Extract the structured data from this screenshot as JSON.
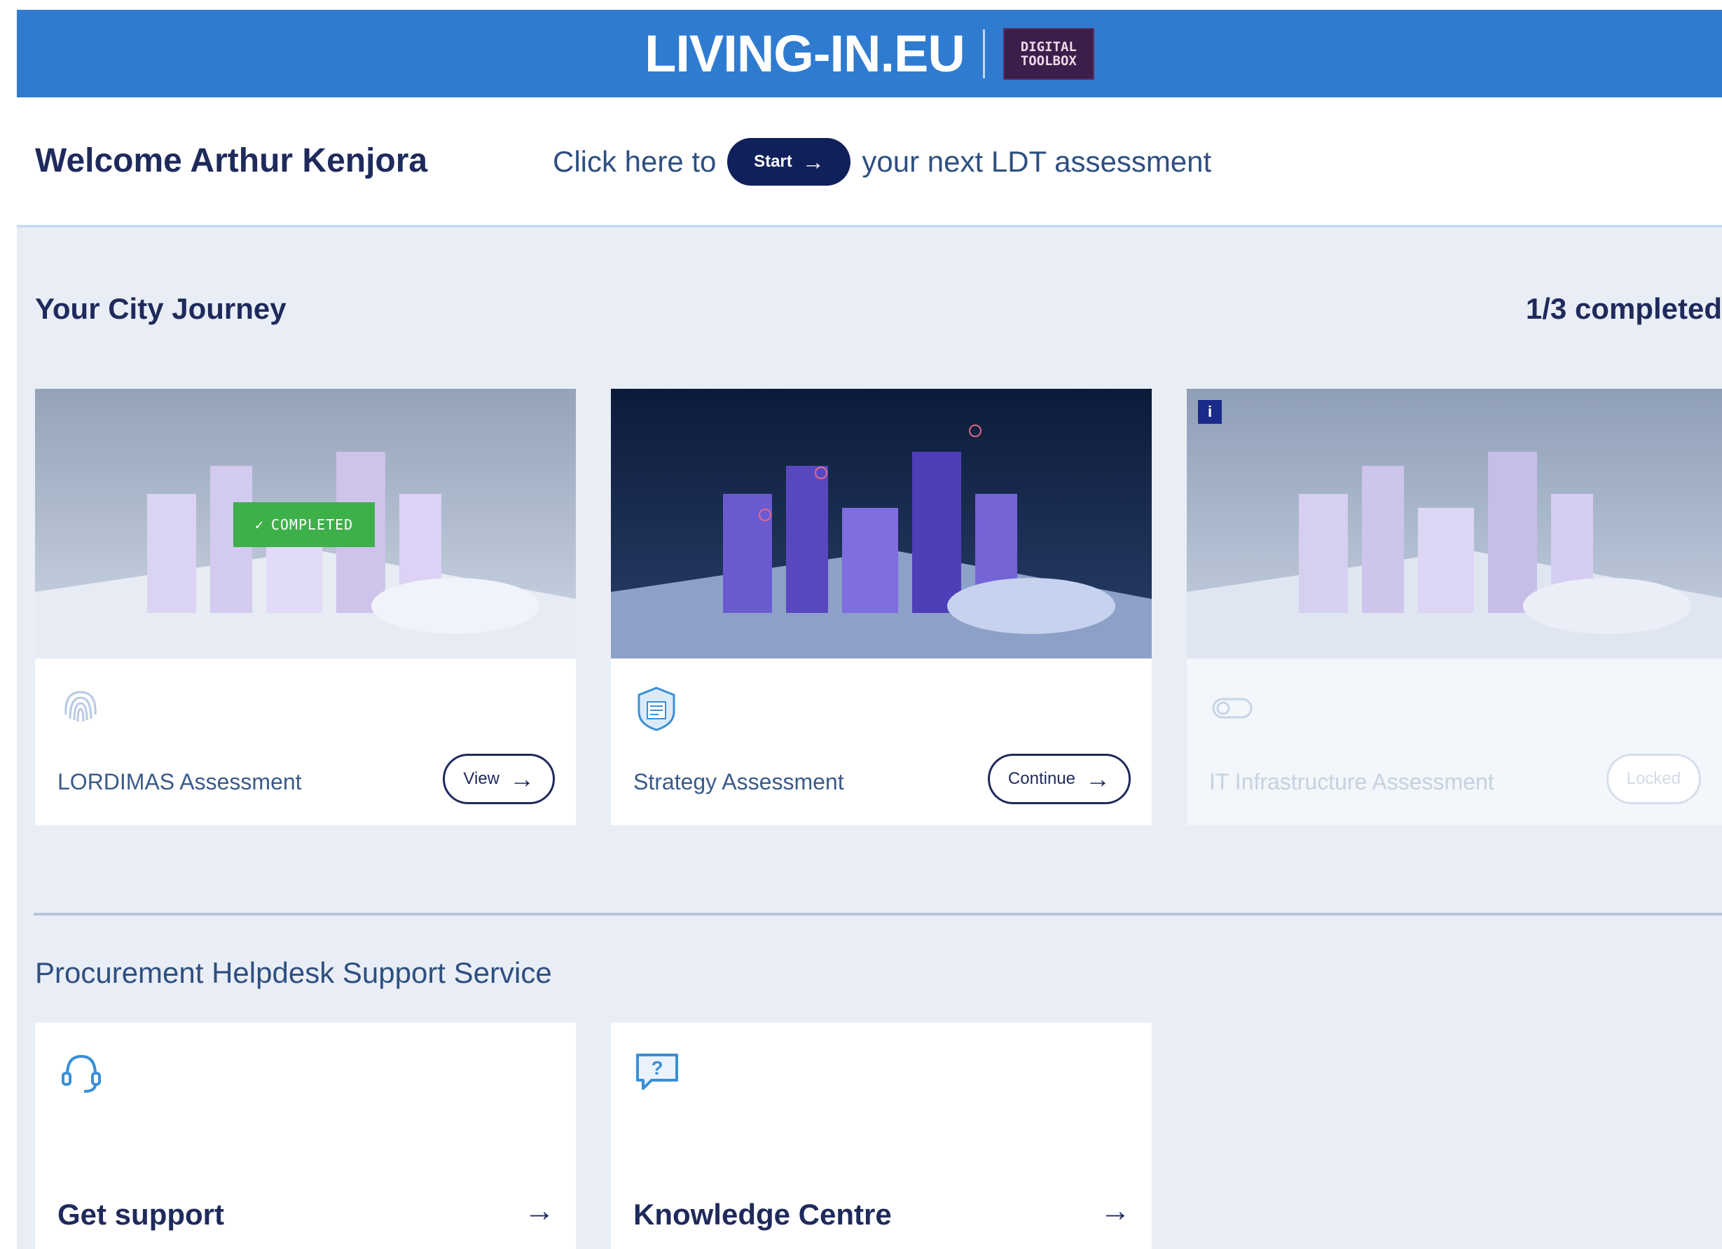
{
  "header": {
    "brand": "LIVING-IN.EU",
    "badge_line1": "DIGITAL",
    "badge_line2": "TOOLBOX"
  },
  "welcome": {
    "greeting": "Welcome Arthur Kenjora",
    "cta_prefix": "Click here to",
    "start_label": "Start",
    "cta_suffix": "your next LDT assessment"
  },
  "journey": {
    "title": "Your City Journey",
    "progress": "1/3 completed",
    "cards": [
      {
        "name": "LORDIMAS Assessment",
        "button": "View",
        "badge": "COMPLETED",
        "icon": "fingerprint-icon"
      },
      {
        "name": "Strategy Assessment",
        "button": "Continue",
        "icon": "shield-document-icon"
      },
      {
        "name": "IT Infrastructure Assessment",
        "button": "Locked",
        "info": "i",
        "icon": "toggle-icon"
      }
    ]
  },
  "helpdesk": {
    "title": "Procurement Helpdesk Support Service",
    "cards": [
      {
        "label": "Get support",
        "icon": "headset-icon"
      },
      {
        "label": "Knowledge Centre",
        "icon": "question-bubble-icon"
      }
    ]
  },
  "colors": {
    "banner": "#2f7bd0",
    "navy": "#10205a",
    "completed_green": "#3db04a",
    "section_bg": "#e9eef6"
  }
}
